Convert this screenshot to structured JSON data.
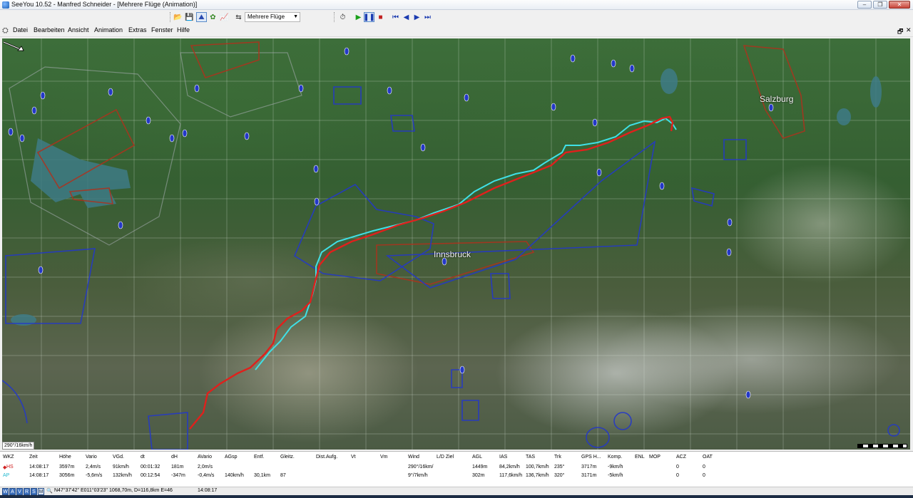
{
  "window": {
    "title": "SeeYou 10.52 - Manfred Schneider - [Mehrere Flüge (Animation)]",
    "buttons": {
      "minimize": "–",
      "maximize": "❐",
      "close": "✕"
    }
  },
  "toolbar": {
    "flight_select": "Mehrere Flüge",
    "icons": [
      "open-folder-icon",
      "save-icon",
      "flight-track-icon",
      "task-icon",
      "barogram-icon",
      "flight-select-icon",
      "clock-icon",
      "play-icon",
      "pause-icon",
      "stop-icon",
      "first-icon",
      "prev-icon",
      "next-icon",
      "last-icon"
    ]
  },
  "menu": {
    "items": [
      "Datei",
      "Bearbeiten",
      "Ansicht",
      "Animation",
      "Extras",
      "Fenster",
      "Hilfe"
    ],
    "mdi": {
      "restore": "🗗",
      "close": "✕"
    }
  },
  "map": {
    "labels": {
      "salzburg": "Salzburg",
      "innsbruck": "Innsbruck"
    },
    "scale_text": "290°/16km/h",
    "colors": {
      "track_hs": "#e0201c",
      "track_ap": "#3fe0e6",
      "airspace_blue": "#2438c8",
      "airspace_red": "#b0301c"
    }
  },
  "table": {
    "headers": [
      "WKZ",
      "Zeit",
      "Höhe",
      "Vario",
      "VGd.",
      "dt",
      "dH",
      "AVario",
      "AGsp",
      "Entf.",
      "Gleitz.",
      "Dist.Aufg.",
      "Vt",
      "Vm",
      "Wind",
      "L/D Ziel",
      "AGL",
      "IAS",
      "TAS",
      "Trk",
      "GPS H...",
      "Komp.",
      "ENL",
      "MOP",
      "ACZ",
      "OAT"
    ],
    "rows": [
      {
        "wkz": "HS",
        "color": "#d02020",
        "values": [
          "14:08:17",
          "3597m",
          "2,4m/s",
          "91km/h",
          "00:01:32",
          "181m",
          "2,0m/s",
          "",
          "",
          "",
          "",
          "",
          "",
          "290°/16km/",
          "",
          "1449m",
          "84,2km/h",
          "100,7km/h",
          "235°",
          "3717m",
          "-9km/h",
          "",
          "",
          "0",
          "0"
        ]
      },
      {
        "wkz": "AP",
        "color": "#20b8d0",
        "values": [
          "14:08:17",
          "3056m",
          "-5,6m/s",
          "132km/h",
          "00:12:54",
          "-347m",
          "-0,4m/s",
          "140km/h",
          "30,1km",
          "87",
          "",
          "",
          "",
          "9°/7km/h",
          "",
          "302m",
          "117,6km/h",
          "136,7km/h",
          "320°",
          "3171m",
          "-5km/h",
          "",
          "",
          "0",
          "0"
        ]
      }
    ]
  },
  "statusbar": {
    "modes": [
      "W",
      "A",
      "V",
      "R",
      "S",
      "M"
    ],
    "coords": "N47°37'42\"  E011°03'23\"  1068,70m, D=116,8km E=46",
    "time": "14:08:17"
  }
}
